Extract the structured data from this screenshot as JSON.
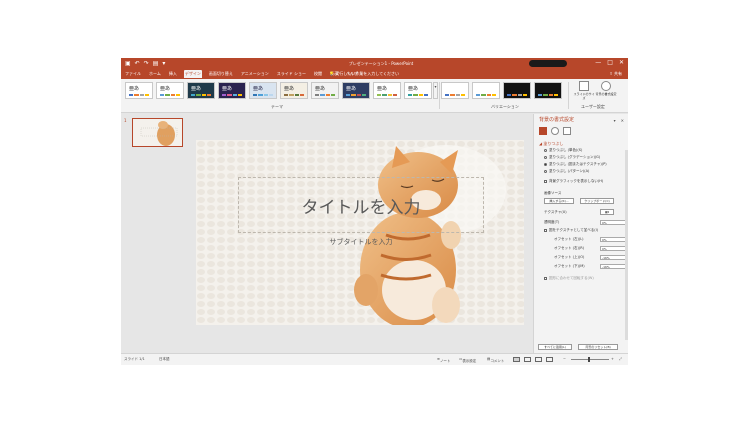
{
  "window": {
    "title": "プレゼンテーション1 - PowerPoint",
    "controls": [
      "—",
      "□",
      "✕"
    ]
  },
  "qat": [
    "▣",
    "↶",
    "↷",
    "▤",
    "▾"
  ],
  "tabs": [
    {
      "label": "ファイル",
      "active": false
    },
    {
      "label": "ホーム",
      "active": false
    },
    {
      "label": "挿入",
      "active": false
    },
    {
      "label": "デザイン",
      "active": true
    },
    {
      "label": "画面切り替え",
      "active": false
    },
    {
      "label": "アニメーション",
      "active": false
    },
    {
      "label": "スライド ショー",
      "active": false
    },
    {
      "label": "校閲",
      "active": false
    },
    {
      "label": "表示",
      "active": false
    },
    {
      "label": "ヘルプ",
      "active": false
    }
  ],
  "tell_me": "実行したい作業を入力してください",
  "share": "共有",
  "ribbon": {
    "themes_group": "テーマ",
    "variants_group": "バリエーション",
    "customize_group": "ユーザー設定",
    "theme_sample": "亜あ",
    "slide_size_label": "スライドのサイズ",
    "format_bg_label": "背景の書式設定"
  },
  "thumbnail": {
    "number": "1"
  },
  "slide": {
    "title_placeholder": "タイトルを入力",
    "subtitle_placeholder": "サブタイトルを入力"
  },
  "format_pane": {
    "title": "背景の書式設定",
    "section_fill": "塗りつぶし",
    "options": [
      {
        "label": "塗りつぶし (単色)(S)",
        "checked": false
      },
      {
        "label": "塗りつぶし (グラデーション)(G)",
        "checked": false
      },
      {
        "label": "塗りつぶし (図またはテクスチャ)(P)",
        "checked": true
      },
      {
        "label": "塗りつぶし (パターン)(A)",
        "checked": false
      }
    ],
    "hide_bg_graphics": "背景グラフィックを表示しない(H)",
    "picture_source": "画像ソース",
    "insert_btn": "挿入する(R)...",
    "clipboard_btn": "クリップボード(C)",
    "texture_label": "テクスチャ(U)",
    "transparency_label": "透明度(T)",
    "transparency_value": "0%",
    "tile_label": "図をテクスチャとして並べる(I)",
    "offsets": [
      {
        "label": "オフセット (左)(L)",
        "value": "0%"
      },
      {
        "label": "オフセット (右)(R)",
        "value": "0%"
      },
      {
        "label": "オフセット (上)(O)",
        "value": "-16%"
      },
      {
        "label": "オフセット (下)(M)",
        "value": "-16%"
      }
    ],
    "rotate_label": "図形に合わせて回転する(W)",
    "apply_all_btn": "すべてに適用(L)",
    "reset_btn": "背景のリセット(B)"
  },
  "status": {
    "slide_count": "スライド 1/1",
    "language": "日本語",
    "notes": "ノート",
    "display_settings": "表示設定",
    "comments": "コメント"
  },
  "colors": {
    "accent": "#b7472a",
    "ribbon_bg": "#f3f3f3",
    "workspace": "#e6e6e6"
  }
}
